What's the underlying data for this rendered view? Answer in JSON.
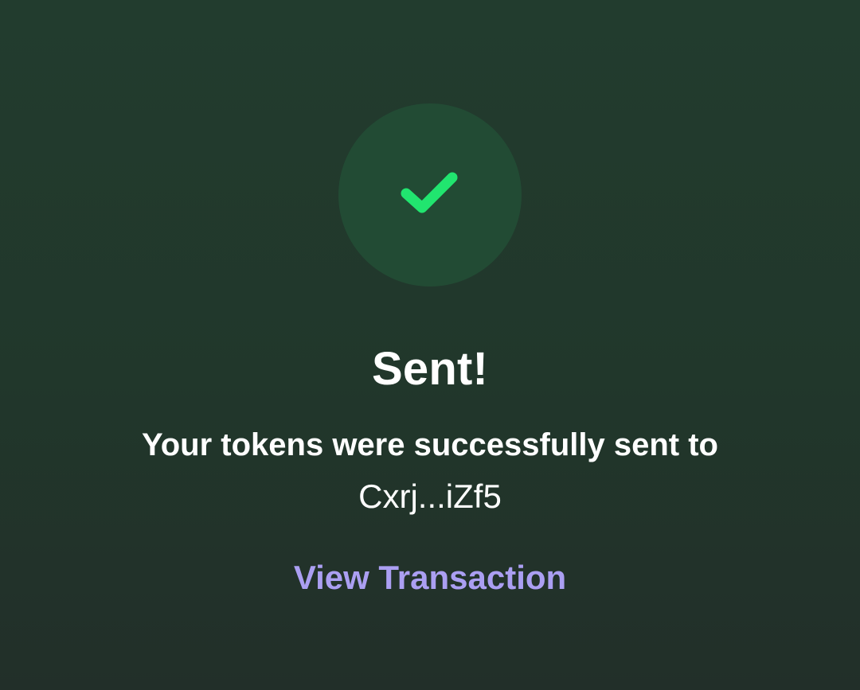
{
  "status": {
    "icon": "checkmark-icon",
    "title": "Sent!",
    "message": "Your tokens were successfully sent to",
    "recipient": "Cxrj...iZf5"
  },
  "actions": {
    "view_transaction_label": "View Transaction"
  },
  "colors": {
    "background_top": "#223c2e",
    "background_bottom": "#222f29",
    "circle": "#224b34",
    "check": "#21e56f",
    "link": "#ab9ff2",
    "text": "#ffffff"
  }
}
